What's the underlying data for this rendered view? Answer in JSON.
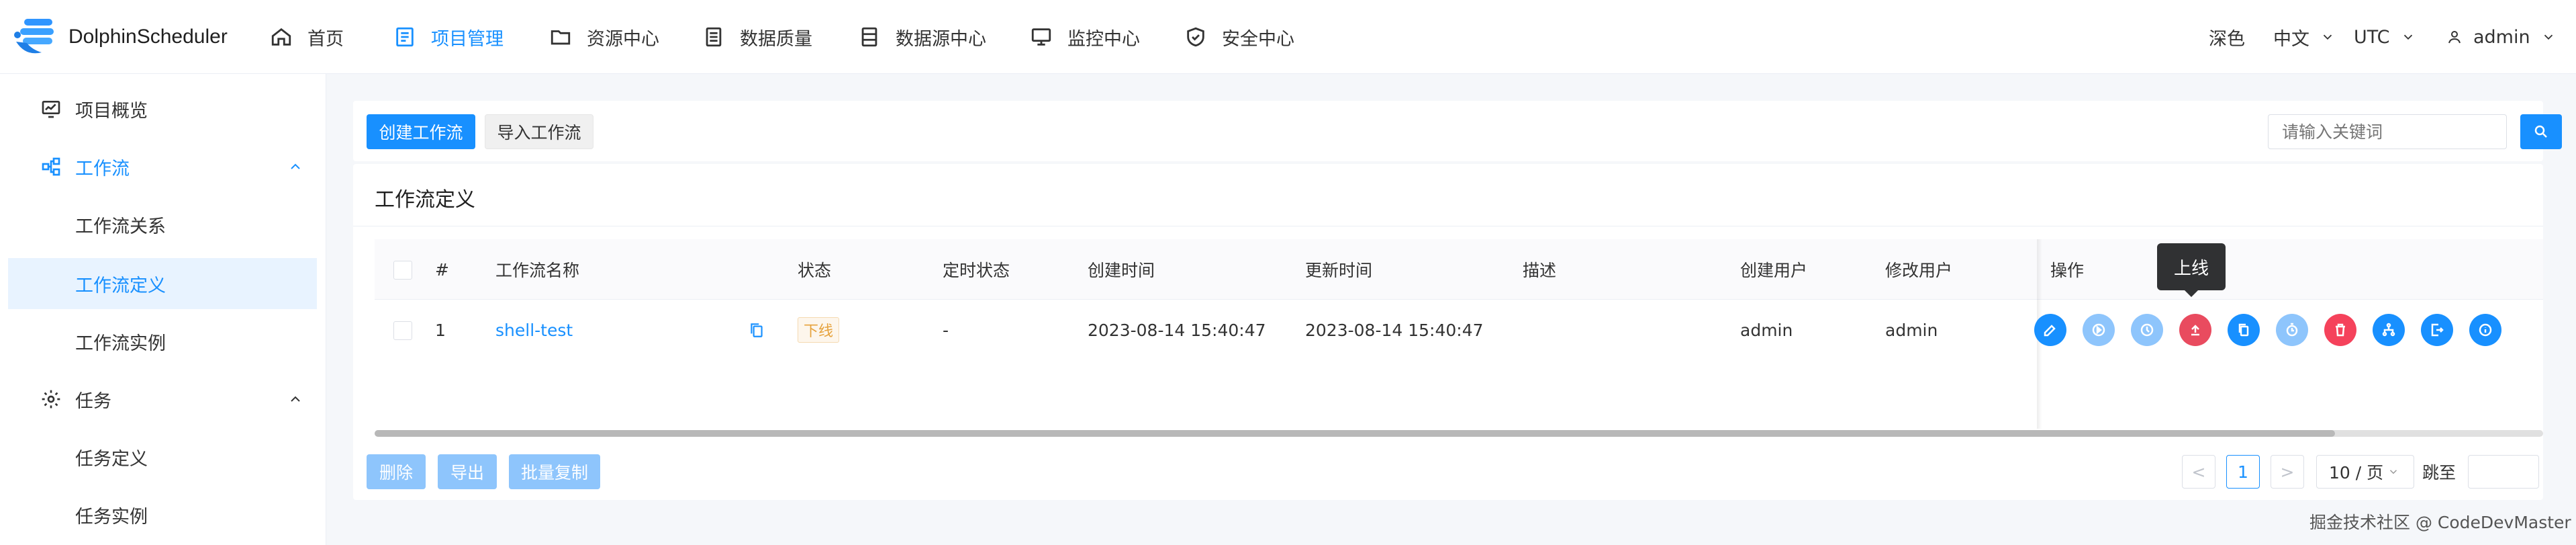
{
  "app": {
    "name": "DolphinScheduler"
  },
  "nav": [
    {
      "label": "首页",
      "icon": "home-icon"
    },
    {
      "label": "项目管理",
      "icon": "project-icon",
      "active": true
    },
    {
      "label": "资源中心",
      "icon": "folder-icon"
    },
    {
      "label": "数据质量",
      "icon": "data-quality-icon"
    },
    {
      "label": "数据源中心",
      "icon": "datasource-icon"
    },
    {
      "label": "监控中心",
      "icon": "monitor-icon"
    },
    {
      "label": "安全中心",
      "icon": "shield-icon"
    }
  ],
  "header_right": {
    "theme": "深色",
    "language": "中文",
    "timezone": "UTC",
    "user": "admin"
  },
  "sidebar": {
    "items": [
      {
        "label": "项目概览",
        "icon": "project-overview-icon"
      },
      {
        "label": "工作流",
        "icon": "workflow-icon",
        "expanded": true
      },
      {
        "label": "工作流关系"
      },
      {
        "label": "工作流定义",
        "selected": true
      },
      {
        "label": "工作流实例"
      },
      {
        "label": "任务",
        "icon": "gear-icon",
        "expanded": true
      },
      {
        "label": "任务定义"
      },
      {
        "label": "任务实例"
      }
    ]
  },
  "toolbar": {
    "create_label": "创建工作流",
    "import_label": "导入工作流",
    "search_placeholder": "请输入关键词"
  },
  "card": {
    "title": "工作流定义"
  },
  "table": {
    "headers": [
      "#",
      "工作流名称",
      "状态",
      "定时状态",
      "创建时间",
      "更新时间",
      "描述",
      "创建用户",
      "修改用户",
      "操作"
    ],
    "rows": [
      {
        "index": "1",
        "name": "shell-test",
        "status": "下线",
        "schedule_status": "-",
        "create_time": "2023-08-14 15:40:47",
        "update_time": "2023-08-14 15:40:47",
        "description": "",
        "creator": "admin",
        "modifier": "admin"
      }
    ]
  },
  "operations": [
    {
      "name": "edit",
      "icon": "edit-icon",
      "color": "#1890ff"
    },
    {
      "name": "run",
      "icon": "play-icon",
      "color": "#8ec5fc"
    },
    {
      "name": "timing",
      "icon": "clock-icon",
      "color": "#8ec5fc"
    },
    {
      "name": "online",
      "icon": "upload-icon",
      "color": "#e94b5f"
    },
    {
      "name": "copy",
      "icon": "copy-icon",
      "color": "#1890ff"
    },
    {
      "name": "cron-manage",
      "icon": "timer-icon",
      "color": "#8ec5fc"
    },
    {
      "name": "delete",
      "icon": "trash-icon",
      "color": "#f5425b"
    },
    {
      "name": "tree-view",
      "icon": "tree-icon",
      "color": "#1890ff"
    },
    {
      "name": "export",
      "icon": "export-icon",
      "color": "#1890ff"
    },
    {
      "name": "version-info",
      "icon": "info-icon",
      "color": "#1890ff"
    }
  ],
  "tooltip": {
    "text": "上线"
  },
  "batch": {
    "delete_label": "删除",
    "export_label": "导出",
    "copy_label": "批量复制"
  },
  "pagination": {
    "prev": "<",
    "current": "1",
    "next": ">",
    "page_size": "10 / 页",
    "jump_label": "跳至"
  },
  "watermark": "掘金技术社区 @ CodeDevMaster"
}
